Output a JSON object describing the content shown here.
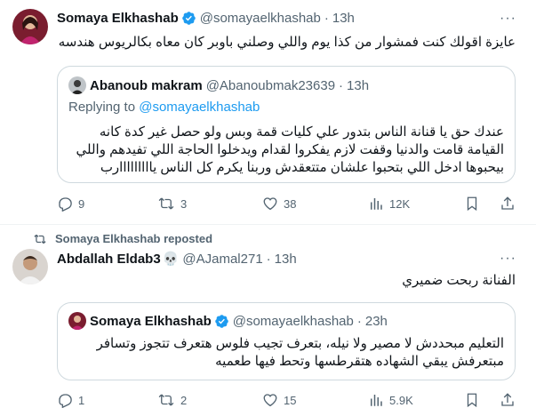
{
  "tweet1": {
    "author_name": "Somaya Elkhashab",
    "author_handle": "@somayaelkhashab",
    "time": "13h",
    "text": "عايزة اقولك كنت فمشوار من كذا يوم واللي وصلني باوبر كان معاه بكالريوس هندسه",
    "quote": {
      "author_name": "Abanoub makram",
      "author_handle": "@Abanoubmak23639",
      "time": "13h",
      "replying_prefix": "Replying to ",
      "replying_to": "@somayaelkhashab",
      "text": "عندك حق يا قنانة الناس بتدور علي كليات قمة وبس ولو حصل غير كدة كانه القيامة قامت والدنيا وقفت لازم يفكروا لقدام ويدخلوا الحاجة اللي تفيدهم واللي بيحبوها ادخل اللي بتحبوا علشان متتعقدش وربنا يكرم كل الناس يااااااااارب"
    },
    "actions": {
      "replies": "9",
      "reposts": "3",
      "likes": "38",
      "views": "12K"
    }
  },
  "tweet2": {
    "repost_label": "Somaya Elkhashab reposted",
    "author_name": "Abdallah Eldab3",
    "author_emoji": "💀",
    "author_handle": "@AJamal271",
    "time": "13h",
    "text": "الفنانة ربحت ضميري",
    "quote": {
      "author_name": "Somaya Elkhashab",
      "author_handle": "@somayaelkhashab",
      "time": "23h",
      "text": "التعليم مبحددش لا مصير ولا نيله، بتعرف تجيب فلوس هتعرف تتجوز وتسافر مبتعرفش يبقي الشهاده هتقرطسها وتحط فيها طعميه"
    },
    "actions": {
      "replies": "1",
      "reposts": "2",
      "likes": "15",
      "views": "5.9K"
    }
  },
  "separator_dot": "·",
  "more_glyph": "···",
  "colors": {
    "text": "#0f1419",
    "muted": "#536471",
    "accent": "#1d9bf0",
    "border": "#cfd9de"
  }
}
